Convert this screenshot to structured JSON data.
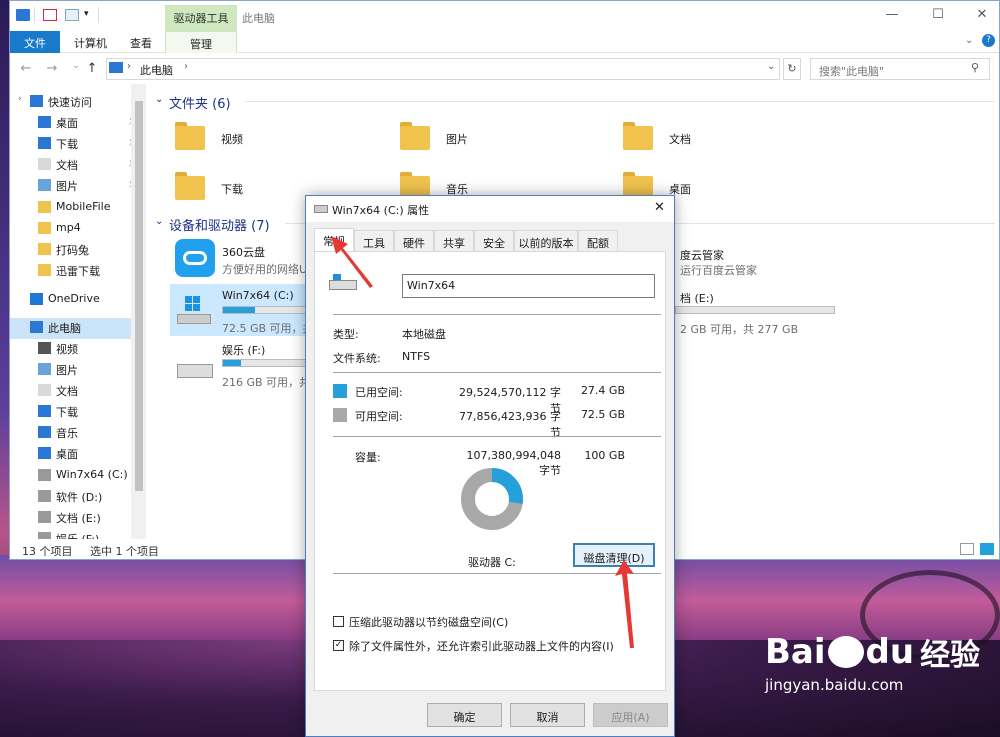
{
  "explorer": {
    "context_tab": "驱动器工具",
    "title": "此电脑",
    "tabs": [
      "文件",
      "计算机",
      "查看",
      "管理"
    ],
    "address": "此电脑",
    "search_placeholder": "搜索\"此电脑\"",
    "sidebar": [
      {
        "label": "快速访问",
        "icon": "star-icon"
      },
      {
        "label": "桌面",
        "icon": "desktop-icon",
        "pinned": true
      },
      {
        "label": "下载",
        "icon": "download-icon",
        "pinned": true
      },
      {
        "label": "文档",
        "icon": "document-icon",
        "pinned": true
      },
      {
        "label": "图片",
        "icon": "picture-icon",
        "pinned": true
      },
      {
        "label": "MobileFile",
        "icon": "folder-icon"
      },
      {
        "label": "mp4",
        "icon": "folder-icon"
      },
      {
        "label": "打码兔",
        "icon": "folder-icon"
      },
      {
        "label": "迅雷下载",
        "icon": "folder-icon"
      },
      {
        "label": "OneDrive",
        "icon": "cloud-icon"
      },
      {
        "label": "此电脑",
        "icon": "computer-icon"
      },
      {
        "label": "视频",
        "icon": "video-icon"
      },
      {
        "label": "图片",
        "icon": "picture-icon"
      },
      {
        "label": "文档",
        "icon": "document-icon"
      },
      {
        "label": "下载",
        "icon": "download-icon"
      },
      {
        "label": "音乐",
        "icon": "music-icon"
      },
      {
        "label": "桌面",
        "icon": "desktop-icon"
      },
      {
        "label": "Win7x64 (C:)",
        "icon": "drive-icon"
      },
      {
        "label": "软件 (D:)",
        "icon": "drive-icon"
      },
      {
        "label": "文档 (E:)",
        "icon": "drive-icon"
      },
      {
        "label": "娱乐 (F:)",
        "icon": "drive-icon"
      }
    ],
    "folders_group": "文件夹 (6)",
    "folders": [
      "视频",
      "图片",
      "文档",
      "下载",
      "音乐",
      "桌面"
    ],
    "drives_group": "设备和驱动器 (7)",
    "drives": [
      {
        "name": "360云盘",
        "desc": "方便好用的网络U盘"
      },
      {
        "name": "Win7x64 (C:)",
        "desc": "72.5 GB 可用，共 1",
        "fill": 0.27
      },
      {
        "name": "娱乐 (F:)",
        "desc": "216 GB 可用，共 2",
        "fill": 0.15
      },
      {
        "name": "度云管家",
        "desc": "运行百度云管家"
      },
      {
        "name": "档 (E:)",
        "desc": "2 GB 可用，共 277 GB",
        "fill": 0.0
      }
    ],
    "status_items": "13 个项目",
    "status_selected": "选中 1 个项目"
  },
  "dialog": {
    "title": "Win7x64 (C:) 属性",
    "tabs": [
      "常规",
      "工具",
      "硬件",
      "共享",
      "安全",
      "以前的版本",
      "配额"
    ],
    "drive_name": "Win7x64",
    "type_label": "类型:",
    "type_value": "本地磁盘",
    "fs_label": "文件系统:",
    "fs_value": "NTFS",
    "used_label": "已用空间:",
    "used_bytes": "29,524,570,112 字节",
    "used_gb": "27.4 GB",
    "free_label": "可用空间:",
    "free_bytes": "77,856,423,936 字节",
    "free_gb": "72.5 GB",
    "cap_label": "容量:",
    "cap_bytes": "107,380,994,048 字节",
    "cap_gb": "100 GB",
    "used_fraction": 0.275,
    "drive_label": "驱动器 C:",
    "cleanup_button": "磁盘清理(D)",
    "compress_label": "压缩此驱动器以节约磁盘空间(C)",
    "index_label": "除了文件属性外，还允许索引此驱动器上文件的内容(I)",
    "ok": "确定",
    "cancel": "取消",
    "apply": "应用(A)",
    "colors": {
      "used": "#26a0da",
      "free": "#a8a8a8"
    }
  },
  "watermark": {
    "brand": "Bai",
    "brand2": "du",
    "cn": "经验",
    "url": "jingyan.baidu.com"
  }
}
